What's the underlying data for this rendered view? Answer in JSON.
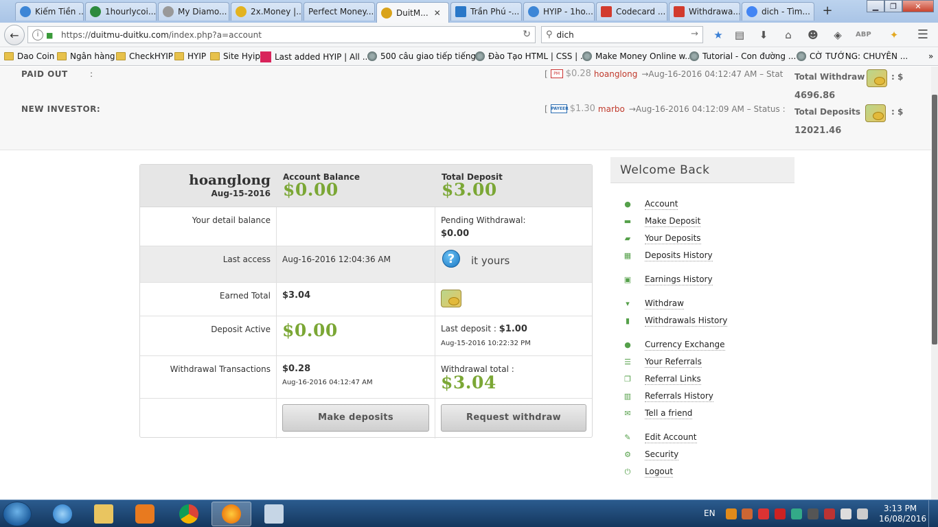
{
  "browser": {
    "tabs": [
      {
        "label": "Kiếm Tiền ...",
        "color": "#3d86d6"
      },
      {
        "label": "1hourlycoi...",
        "color": "#2e8b3e"
      },
      {
        "label": "My Diamo...",
        "color": "#999999"
      },
      {
        "label": "2x.Money |...",
        "color": "#e3b320"
      },
      {
        "label": "Perfect Money...",
        "color": ""
      },
      {
        "label": "DuitM...",
        "color": "#d9a31b",
        "active": true
      },
      {
        "label": "Trần Phú -...",
        "color": "#2a78c8"
      },
      {
        "label": "HYIP - 1ho...",
        "color": "#3d86d6"
      },
      {
        "label": "Codecard ...",
        "color": "#d23b2e"
      },
      {
        "label": "Withdrawa...",
        "color": "#d23b2e"
      },
      {
        "label": "dich - Tìm...",
        "color": "#4285f4"
      }
    ],
    "new_tab": "+",
    "url_prefix": "https://",
    "url_domain": "duitmu-duitku.com",
    "url_path": "/index.php?a=account",
    "search_value": "dich",
    "bookmarks": [
      {
        "label": "Dao Coin",
        "icon": "folder"
      },
      {
        "label": "Ngân hàng",
        "icon": "folder"
      },
      {
        "label": "CheckHYIP",
        "icon": "folder"
      },
      {
        "label": "HYIP",
        "icon": "folder"
      },
      {
        "label": "Site Hyip",
        "icon": "folder"
      },
      {
        "label": "Last added HYIP | All ...",
        "icon": "a-logo"
      },
      {
        "label": "500 câu giao tiếp tiếng...",
        "icon": "globe"
      },
      {
        "label": "Đào Tạo HTML | CSS | ...",
        "icon": "globe"
      },
      {
        "label": "Make Money Online w...",
        "icon": "globe"
      },
      {
        "label": "Tutorial - Con đường ...",
        "icon": "globe"
      },
      {
        "label": "CỜ TƯỚNG: CHUYÊN ...",
        "icon": "globe"
      }
    ],
    "more_bookmarks": "»"
  },
  "stats": {
    "paid_out_label": "PAID OUT",
    "new_investor_label": "NEW INVESTOR:",
    "colon": ":",
    "payout": {
      "open": "[",
      "amount": "$0.28",
      "user": "hoanglong",
      "time": "→Aug-16-2016 04:12:47 AM – Stat"
    },
    "investor": {
      "open": "[",
      "amount": "$1.30",
      "user": "marbo",
      "time": "→Aug-16-2016 04:12:09 AM – Status :"
    },
    "total_withdraw_label": "Total Withdraw",
    "total_withdraw_value": "4696.86",
    "total_deposits_label": "Total Deposits",
    "total_deposits_value": "12021.46",
    "currency_suffix": ": $"
  },
  "account": {
    "username": "hoanglong",
    "join_date": "Aug-15-2016",
    "balance_label": "Account Balance",
    "balance_value": "$0.00",
    "total_deposit_label": "Total Deposit",
    "total_deposit_value": "$3.00",
    "detail_balance_label": "Your detail balance",
    "pending_withdrawal_label": "Pending Withdrawal:",
    "pending_withdrawal_value": "$0.00",
    "last_access_label": "Last access",
    "last_access_value": "Aug-16-2016 12:04:36 AM",
    "help_text": "it yours",
    "earned_total_label": "Earned Total",
    "earned_total_value": "$3.04",
    "deposit_active_label": "Deposit Active",
    "deposit_active_value": "$0.00",
    "last_deposit_label": "Last deposit :",
    "last_deposit_value": "$1.00",
    "last_deposit_date": "Aug-15-2016 10:22:32 PM",
    "withdrawal_tx_label": "Withdrawal Transactions",
    "withdrawal_tx_value": "$0.28",
    "withdrawal_tx_date": "Aug-16-2016 04:12:47 AM",
    "withdrawal_total_label": "Withdrawal total :",
    "withdrawal_total_value": "$3.04",
    "make_deposits_btn": "Make deposits",
    "request_withdraw_btn": "Request withdraw"
  },
  "sidebar": {
    "title": "Welcome Back",
    "items": [
      {
        "label": "Account",
        "icon": "user-icon",
        "glyph": "●"
      },
      {
        "label": "Make Deposit",
        "icon": "credit-card-icon",
        "glyph": "▬"
      },
      {
        "label": "Your Deposits",
        "icon": "briefcase-icon",
        "glyph": "▰"
      },
      {
        "label": "Deposits History",
        "icon": "table-icon",
        "glyph": "▦"
      },
      {
        "label": "Earnings History",
        "icon": "money-icon",
        "glyph": "▣"
      },
      {
        "label": "Withdraw",
        "icon": "cart-icon",
        "glyph": "▾"
      },
      {
        "label": "Withdrawals History",
        "icon": "list-icon",
        "glyph": "▮"
      },
      {
        "label": "Currency Exchange",
        "icon": "user-icon",
        "glyph": "●"
      },
      {
        "label": "Your Referrals",
        "icon": "list-icon",
        "glyph": "☰"
      },
      {
        "label": "Referral Links",
        "icon": "copy-icon",
        "glyph": "❐"
      },
      {
        "label": "Referrals History",
        "icon": "bar-chart-icon",
        "glyph": "▥"
      },
      {
        "label": "Tell a friend",
        "icon": "envelope-icon",
        "glyph": "✉"
      },
      {
        "label": "Edit Account",
        "icon": "wrench-icon",
        "glyph": "✎"
      },
      {
        "label": "Security",
        "icon": "gears-icon",
        "glyph": "⚙"
      },
      {
        "label": "Logout",
        "icon": "power-icon",
        "glyph": "⏻"
      }
    ]
  },
  "taskbar": {
    "language": "EN",
    "time": "3:13 PM",
    "date": "16/08/2016"
  },
  "colors": {
    "accent_green": "#7ba735",
    "username_red": "#c0392b"
  }
}
